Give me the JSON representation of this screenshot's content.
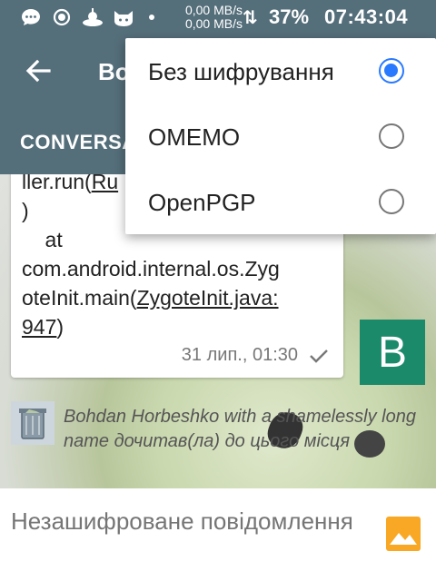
{
  "status_bar": {
    "net_speed_up": "0,00 MB/s",
    "net_speed_down": "0,00 MB/s",
    "battery": "37%",
    "time": "07:43:04",
    "icons": [
      "chat-bubble-icon",
      "record-icon",
      "alien-icon",
      "cat-icon",
      "dot-icon",
      "data-arrows-icon"
    ]
  },
  "toolbar": {
    "back_icon": "arrow-left-icon",
    "title": "Bo"
  },
  "tabs": {
    "conversation": "CONVERSATION"
  },
  "message": {
    "lines": [
      {
        "text": "ller.run(",
        "link": "Ru"
      },
      {
        "text": ")"
      },
      {
        "text": "    at"
      },
      {
        "text": "com.android.internal.os.Zyg"
      },
      {
        "text": "oteInit.main(",
        "link": "ZygoteInit.java:"
      },
      {
        "link": "947",
        "text_after": ")"
      }
    ],
    "timestamp": "31 лип., 01:30",
    "status_icon": "check-icon"
  },
  "avatar": {
    "letter": "B",
    "color": "#1b8a6b"
  },
  "read_marker": {
    "text": "Bohdan Horbeshko with a shamelessly long name дочитав(ла) до цього місця",
    "icon": "trash-can-icon"
  },
  "input": {
    "placeholder": "Незашифроване повідомлення",
    "attach_icon": "image-icon",
    "attach_color": "#f9a825"
  },
  "encryption_menu": {
    "items": [
      {
        "label": "Без шифрування",
        "checked": true
      },
      {
        "label": "OMEMO",
        "checked": false
      },
      {
        "label": "OpenPGP",
        "checked": false
      }
    ],
    "accent": "#2979ff"
  },
  "colors": {
    "primary": "#546e7a"
  }
}
